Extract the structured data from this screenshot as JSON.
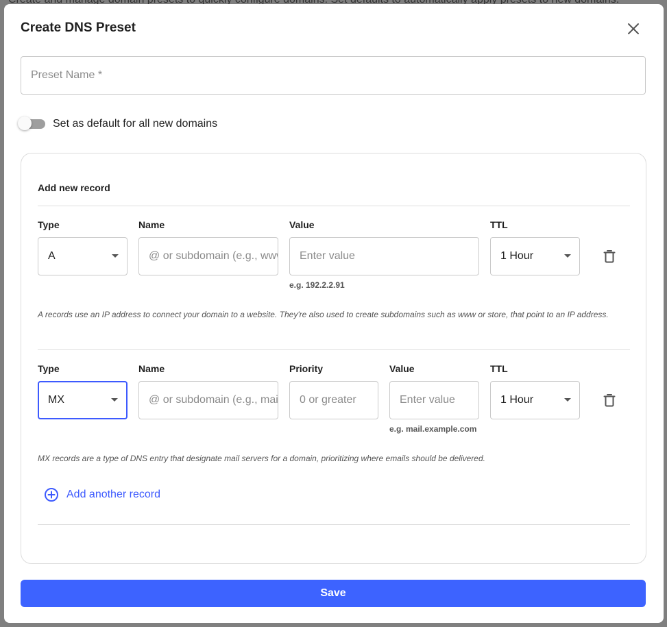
{
  "background": {
    "text": "Create and manage domain presets to quickly configure domains. Set defaults to automatically apply presets to new domains."
  },
  "modal": {
    "title": "Create DNS Preset",
    "preset_name_placeholder": "Preset Name *",
    "default_toggle_label": "Set as default for all new domains",
    "default_toggle_on": false,
    "section_title": "Add new record",
    "records": [
      {
        "type_label": "Type",
        "type_value": "A",
        "name_label": "Name",
        "name_placeholder": "@ or subdomain (e.g., www)",
        "value_label": "Value",
        "value_placeholder": "Enter value",
        "value_helper": "e.g. 192.2.2.91",
        "ttl_label": "TTL",
        "ttl_value": "1 Hour",
        "description": "A records use an IP address to connect your domain to a website. They're also used to create subdomains such as www or store, that point to an IP address."
      },
      {
        "type_label": "Type",
        "type_value": "MX",
        "name_label": "Name",
        "name_placeholder": "@ or subdomain (e.g., mail)",
        "priority_label": "Priority",
        "priority_placeholder": "0 or greater",
        "value_label": "Value",
        "value_placeholder": "Enter value",
        "value_helper": "e.g. mail.example.com",
        "ttl_label": "TTL",
        "ttl_value": "1 Hour",
        "description": "MX records are a type of DNS entry that designate mail servers for a domain, prioritizing where emails should be delivered."
      }
    ],
    "add_record_label": "Add another record",
    "save_label": "Save"
  },
  "colors": {
    "accent": "#3d5afe",
    "save_button": "#3d63ff",
    "overlay": "#7f7f7f"
  },
  "icons": {
    "close": "close-icon",
    "trash": "trash-icon",
    "add": "add-circle-icon",
    "dropdown": "chevron-down-icon"
  }
}
